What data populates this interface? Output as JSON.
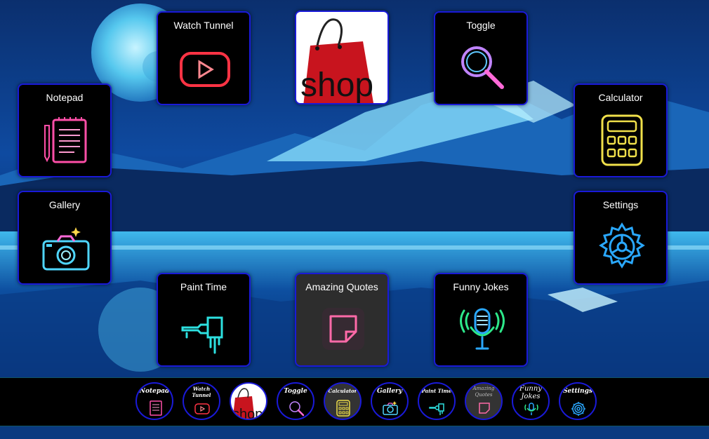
{
  "tiles": {
    "watch_tunnel": "Watch Tunnel",
    "toggle": "Toggle",
    "notepad": "Notepad",
    "calculator": "Calculator",
    "gallery": "Gallery",
    "settings": "Settings",
    "paint_time": "Paint Time",
    "amazing_quotes": "Amazing Quotes",
    "funny_jokes": "Funny Jokes",
    "shop_logo_text": "shop"
  },
  "dock": {
    "notepad": "Notepad",
    "watch_tunnel_1": "Watch",
    "watch_tunnel_2": "Tunnel",
    "toggle": "Toggle",
    "calculator": "Calculator",
    "gallery": "Gallery",
    "paint_time": "Paint Time",
    "amazing_quotes_1": "Amazing",
    "amazing_quotes_2": "Quotes",
    "funny_jokes_1": "Funny",
    "funny_jokes_2": "Jokes",
    "settings": "Settings",
    "shop_logo_text": "shop"
  },
  "colors": {
    "tile_border": "#1a1ad8",
    "youtube_red": "#ff3344",
    "notepad_pink": "#ff4fa8",
    "calculator_yellow": "#f0e04a",
    "gallery_cyan": "#4fd6ff",
    "settings_blue": "#2aa8ff",
    "paint_cyan": "#2de0e0",
    "quotes_pink": "#ff6aa8",
    "jokes_green": "#2de88a"
  }
}
